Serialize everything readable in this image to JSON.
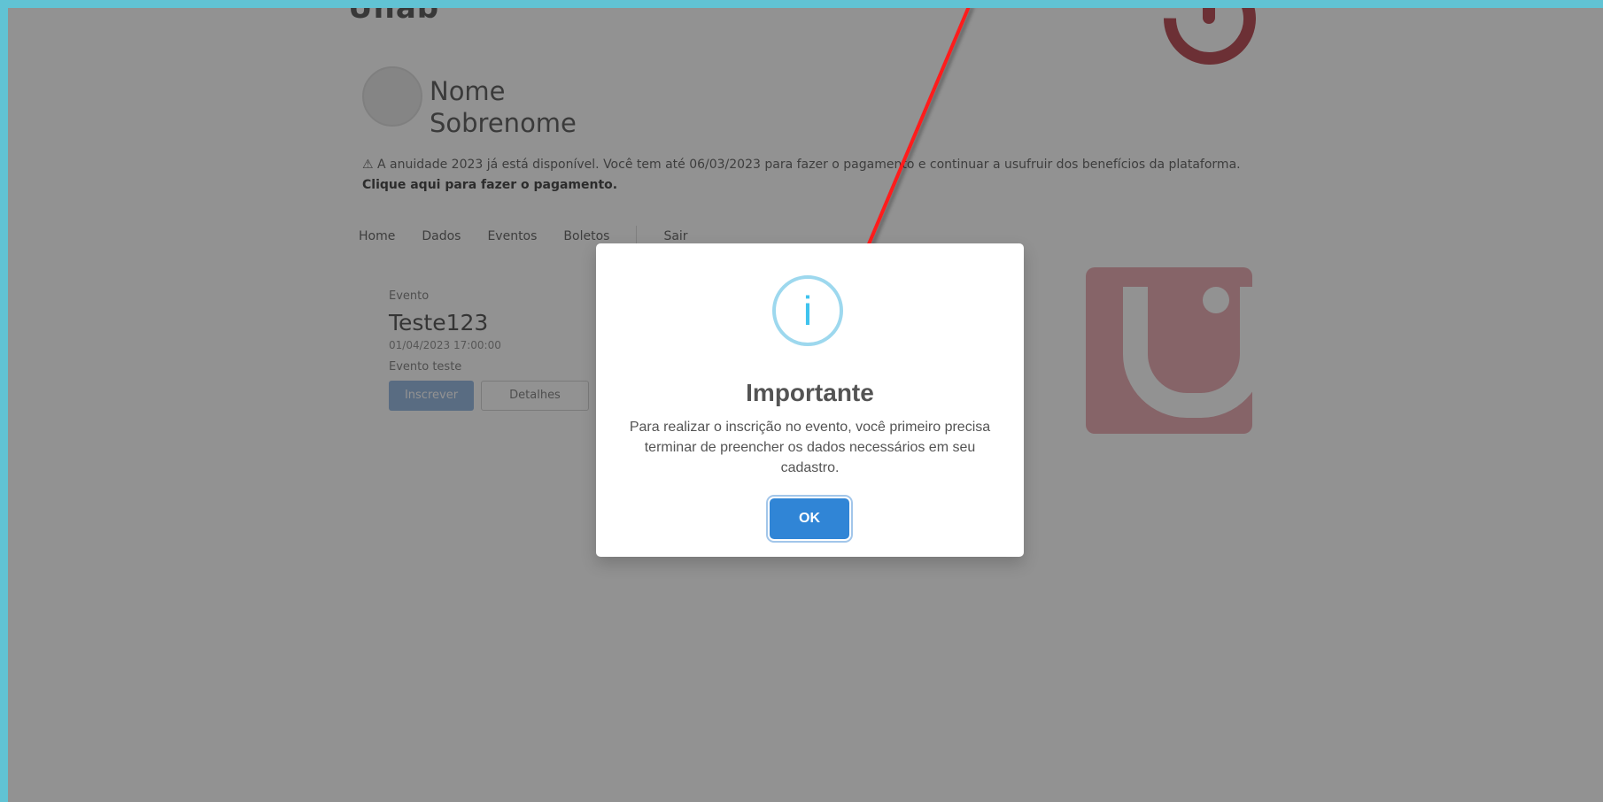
{
  "page": {
    "brand_text": "Unab",
    "user_first_name": "Nome",
    "user_last_name": "Sobrenome",
    "notice_text": "A anuidade 2023 já está disponível. Você tem até 06/03/2023 para fazer o pagamento e continuar a usufruir dos benefícios da plataforma.",
    "notice_link": "Clique aqui para fazer o pagamento.",
    "nav": [
      {
        "label": "Home"
      },
      {
        "label": "Dados"
      },
      {
        "label": "Eventos"
      },
      {
        "label": "Boletos"
      },
      {
        "label": "Sair"
      }
    ],
    "event": {
      "kicker": "Evento",
      "title": "Teste123",
      "date": "01/04/2023 17:00:00",
      "description": "Evento teste",
      "primary_action": "Inscrever",
      "secondary_action": "Detalhes"
    }
  },
  "modal": {
    "icon_glyph": "i",
    "title": "Importante",
    "message": "Para realizar o inscrição no evento, você primeiro precisa terminar de preencher os dados necessários em seu cadastro.",
    "ok_label": "OK"
  },
  "colors": {
    "outer_frame": "#61c3d4",
    "modal_button": "#3085d6",
    "icon_ring": "#9dd8ee",
    "icon_glyph": "#3fc3ee",
    "arrow": "#ff1a1a",
    "backdrop": "rgba(38,38,38,0.5)",
    "brand_banner": "#e6a3ab"
  },
  "icons": {
    "info": "info-icon",
    "brand": "brand-logo-icon",
    "annotation": "annotation-arrow-icon"
  }
}
